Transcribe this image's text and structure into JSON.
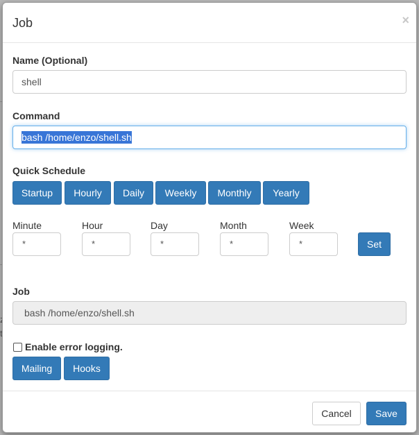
{
  "background": {
    "fragment_1": "z",
    "fragment_2": "t"
  },
  "modal": {
    "title": "Job",
    "close_glyph": "×",
    "name": {
      "label": "Name (Optional)",
      "value": "shell"
    },
    "command": {
      "label": "Command",
      "value": "bash /home/enzo/shell.sh"
    },
    "quick_schedule": {
      "label": "Quick Schedule",
      "buttons": [
        "Startup",
        "Hourly",
        "Daily",
        "Weekly",
        "Monthly",
        "Yearly"
      ]
    },
    "schedule_fields": [
      {
        "label": "Minute",
        "value": "*"
      },
      {
        "label": "Hour",
        "value": "*"
      },
      {
        "label": "Day",
        "value": "*"
      },
      {
        "label": "Month",
        "value": "*"
      },
      {
        "label": "Week",
        "value": "*"
      }
    ],
    "set_label": "Set",
    "job": {
      "label": "Job",
      "value": "bash /home/enzo/shell.sh"
    },
    "error_logging_label": "Enable error logging.",
    "mailing_label": "Mailing",
    "hooks_label": "Hooks",
    "cancel_label": "Cancel",
    "save_label": "Save"
  },
  "colors": {
    "primary": "#337ab7",
    "backdrop": "#b9b9b9",
    "focus_border": "#66afe9",
    "selection": "#3875d7"
  }
}
